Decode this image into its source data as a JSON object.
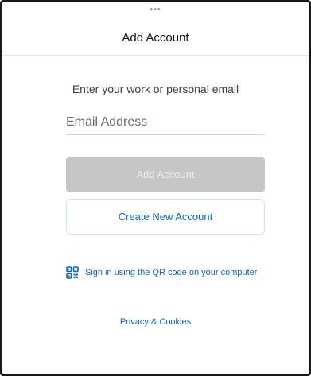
{
  "header": {
    "grabber": "•••",
    "title": "Add Account"
  },
  "main": {
    "prompt": "Enter your work or personal email",
    "email": {
      "value": "",
      "placeholder": "Email Address"
    },
    "add_account_label": "Add Account",
    "create_account_label": "Create New Account",
    "qr_signin_label": "Sign in using the QR code on your computer",
    "qr_icon": "qr-code-icon",
    "privacy_label": "Privacy & Cookies"
  },
  "colors": {
    "accent": "#0e64b8",
    "disabled_button": "#c6c6c6",
    "outline_button_border": "#cde2f6"
  }
}
